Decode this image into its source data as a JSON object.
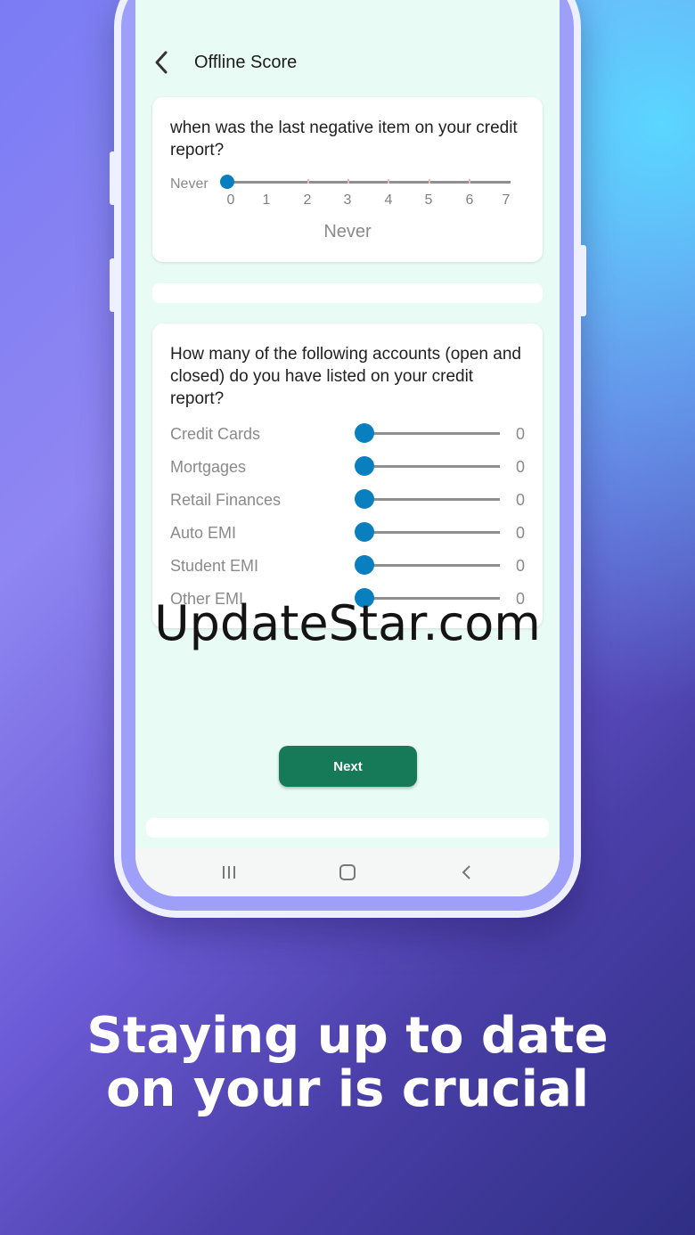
{
  "appbar": {
    "title": "Offline Score",
    "back_icon": "chevron-left-icon"
  },
  "question1": {
    "text": "when was the last negative item on your credit report?",
    "slider_min_label": "Never",
    "ticks": [
      "0",
      "1",
      "2",
      "3",
      "4",
      "5",
      "6",
      "7"
    ],
    "selected_value_label": "Never",
    "value": 0
  },
  "question2": {
    "text": "How many of the following accounts (open and closed) do you have listed on your credit report?",
    "rows": [
      {
        "label": "Credit Cards",
        "value": "0"
      },
      {
        "label": "Mortgages",
        "value": "0"
      },
      {
        "label": "Retail Finances",
        "value": "0"
      },
      {
        "label": "Auto EMI",
        "value": "0"
      },
      {
        "label": "Student EMI",
        "value": "0"
      },
      {
        "label": "Other EMI",
        "value": "0"
      }
    ]
  },
  "next_button": {
    "label": "Next"
  },
  "navbar": {
    "recents_icon": "recents-icon",
    "home_icon": "home-icon",
    "back_icon": "back-icon"
  },
  "watermark": "UpdateStar.com",
  "headline": {
    "line1": "Staying up to date",
    "line2": "on your is crucial"
  },
  "colors": {
    "accent": "#0a7fc0",
    "button": "#167a59",
    "screen_bg": "#e9fbf5"
  }
}
